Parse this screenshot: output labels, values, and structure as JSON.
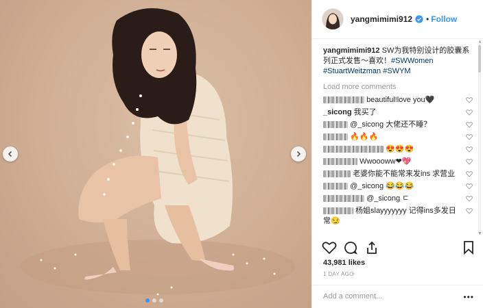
{
  "post": {
    "username": "yangmimimi912",
    "follow_separator": "•",
    "follow_label": "Follow",
    "carousel": {
      "slide_count": 3,
      "active_slide": 1
    }
  },
  "caption": {
    "username": "yangmimimi912",
    "text": " SW为我特别设计的胶囊系列正式发售～喜欢！",
    "hashtags": [
      "#SWWomen",
      "#StuartWeitzman",
      "#SWYM"
    ]
  },
  "load_more": "Load more comments",
  "comments": [
    {
      "user": "",
      "text": "beautiful!love you🖤"
    },
    {
      "user": "_sicong",
      "text": " 我买了"
    },
    {
      "user": "",
      "text": "@_sicong 大佬还不睡？"
    },
    {
      "user": "",
      "text": "🔥🔥🔥"
    },
    {
      "user": "",
      "text": "😍😍😍"
    },
    {
      "user": "",
      "text": "Wwoooww❤💖"
    },
    {
      "user": "",
      "text": "老婆你能不能常来发ins 求营业"
    },
    {
      "user": "",
      "text": "@_sicong 😂😂😂"
    },
    {
      "user": "",
      "text": "@_sicong ㄷ"
    },
    {
      "user": "",
      "text": "杨姐slayyyyyyy 记得ins多发日常😏"
    }
  ],
  "likes": "43,981 likes",
  "timestamp": "1 DAY AGO",
  "add_comment_placeholder": "Add a comment...",
  "more_options": "•••",
  "colors": {
    "link": "#3897f0",
    "hashtag": "#003569",
    "muted": "#999999",
    "text": "#262626"
  },
  "icons": [
    "chevron-left-icon",
    "chevron-right-icon",
    "verified-badge-icon",
    "heart-icon",
    "comment-icon",
    "share-icon",
    "bookmark-icon"
  ]
}
